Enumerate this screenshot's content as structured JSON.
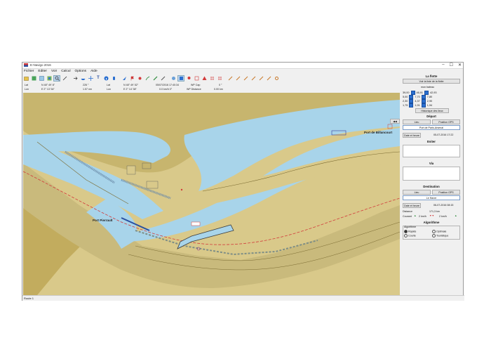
{
  "window": {
    "title": "E-Navigo 2016",
    "controls": [
      "–",
      "☐",
      "✕"
    ]
  },
  "menu": [
    "Fichier",
    "Editer",
    "Voir",
    "Calcul",
    "Options",
    "Aide"
  ],
  "toolbar": {
    "icons": [
      "open-icon",
      "layers-icon",
      "chart-icon",
      "map-icon",
      "zoom-icon",
      "measure-icon",
      "arrow-icon",
      "boat-icon",
      "crosshair-icon",
      "text-icon",
      "info-icon",
      "hand-icon",
      "plane-icon",
      "flag-icon",
      "dot-icon",
      "route-icon",
      "pencil-icon",
      "tool-icon",
      "star-icon",
      "target-icon",
      "pin-icon",
      "select-icon",
      "warning-icon",
      "grid-icon",
      "grid-icon",
      "waves-icon",
      "hook-icon",
      "hook-icon",
      "edit-icon",
      "trash-icon",
      "ruler-icon",
      "gear-icon"
    ]
  },
  "info": {
    "lat1_label": "Lat",
    "lat1_value": "N 48° 49' 8\"",
    "lon1_label": "Lon",
    "lon1_value": "E 2° 13' 54\"",
    "heading_value": "226 °",
    "distance_value": "1.57 nm",
    "lat2_label": "Lat",
    "lat2_value": "N 48° 49' 52\"",
    "lon2_label": "Lon",
    "lon2_value": "E 2° 14' 38\"",
    "date_value": "05/07/2016 17:40:34",
    "speed_value": "0.0 km/h  0°",
    "wp_cap_label": "WP Cap",
    "wp_cap_value": "0 °",
    "wp_dist_label": "WP Distance",
    "wp_dist_value": "0.00 km"
  },
  "map": {
    "labels": {
      "port_billancourt": "Port de Billancourt",
      "port_pierrault": "Port Pierrault"
    }
  },
  "panel": {
    "flotte_title": "La flotte",
    "flotte_btn": "Voir la liste de la flotte",
    "boat_name": "mon bateau",
    "wind_rows": [
      {
        "left": "39,00",
        "right": "46,91",
        "far": "42,93"
      },
      {
        "left": "5,00",
        "right": "7,70",
        "far": "7,80"
      },
      {
        "left": "2,30",
        "right": "4,37",
        "far": "2,90"
      },
      {
        "left": "1,75",
        "right": "1,91",
        "far": "1,94"
      }
    ],
    "history_btn": "Historique des lieux",
    "depart_title": "Départ",
    "lieu_btn": "Lieu",
    "gps_btn": "Position GPS",
    "depart_place": "Port de Paris-Arsenal",
    "date_btn": "Date et heure",
    "depart_date": "05-07-2016 17:22",
    "eviter_title": "Eviter",
    "via_title": "Via",
    "dest_title": "Destination",
    "dest_lieu_btn": "Lieu",
    "dest_gps_btn": "Position GPS",
    "dest_place": "Le Havre",
    "dest_date_btn": "Date et heure",
    "dest_date": "06-07-2016 08:15",
    "distance_label": "Distance",
    "distance_value": "171,3 km",
    "courant_label": "Courant",
    "courant_a": "2 km/h",
    "courant_b": "2 km/h",
    "algo_title": "Algorithme",
    "algo_group": "Algorithme",
    "opt_rapide": "Rapide",
    "opt_optimale": "Optimale",
    "opt_courte": "Courte",
    "opt_touristique": "Touristique"
  },
  "status": {
    "text": "Route 1"
  },
  "colors": {
    "land": "#d9c98a",
    "land_dark": "#c2ac5e",
    "water": "#a8d4ea",
    "route": "#d23b3b",
    "accent": "#2a6fd0"
  }
}
